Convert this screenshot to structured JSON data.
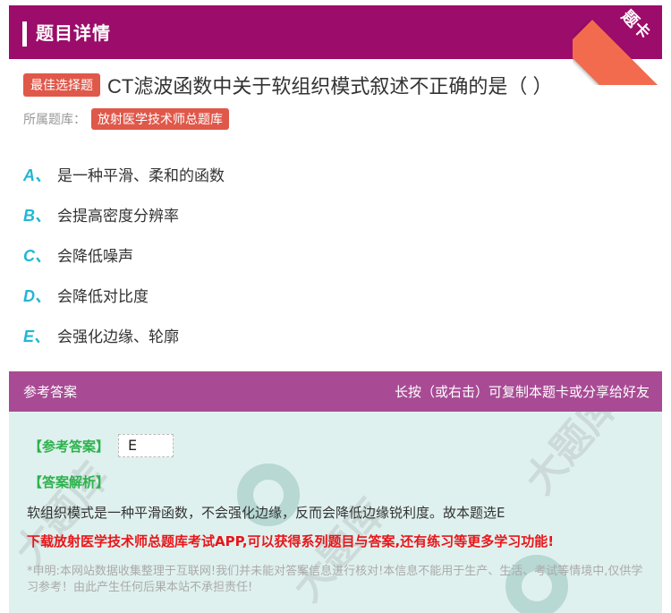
{
  "header": {
    "title": "题目详情",
    "ribbon": "题卡"
  },
  "question": {
    "badge": "最佳选择题",
    "title": "CT滤波函数中关于软组织模式叙述不正确的是（ ）",
    "bank_label": "所属题库：",
    "bank_name": "放射医学技术师总题库"
  },
  "options": [
    {
      "letter": "A、",
      "text": "是一种平滑、柔和的函数"
    },
    {
      "letter": "B、",
      "text": "会提高密度分辨率"
    },
    {
      "letter": "C、",
      "text": "会降低噪声"
    },
    {
      "letter": "D、",
      "text": "会降低对比度"
    },
    {
      "letter": "E、",
      "text": "会强化边缘、轮廓"
    }
  ],
  "answer": {
    "header_left": "参考答案",
    "header_right": "长按（或右击）可复制本题卡或分享给好友",
    "key_label": "【参考答案】",
    "key_value": "E",
    "analysis_label": "【答案解析】",
    "analysis_text": "软组织模式是一种平滑函数，不会强化边缘，反而会降低边缘锐利度。故本题选E",
    "download_text": "下载放射医学技术师总题库考试APP,可以获得系列题目与答案,还有练习等更多学习功能!",
    "disclaimer": "*申明:本网站数据收集整理于互联网!我们并未能对答案信息进行核对!本信息不能用于生产、生活、考试等情境中,仅供学习参考！由此产生任何后果本站不承担责任!"
  },
  "colors": {
    "header_bg": "#9c0c6a",
    "ribbon": "#f26b4e",
    "badge": "#e0584a",
    "option_letter": "#22b6d4",
    "answer_header_bg": "#a84b94",
    "answer_body_bg": "#dff1ee",
    "answer_label": "#2cb24c",
    "download_text": "#e8161b"
  }
}
